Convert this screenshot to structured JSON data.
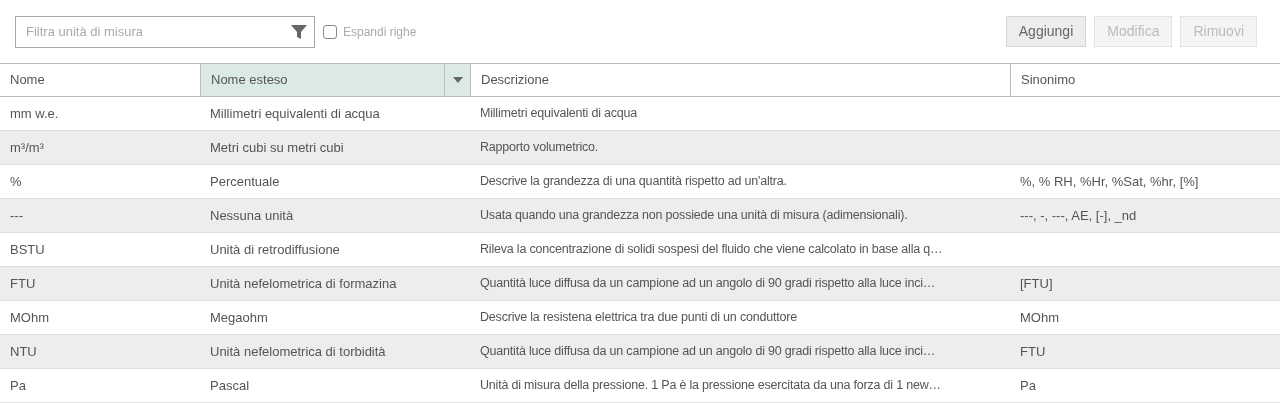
{
  "filter": {
    "placeholder": "Filtra unità di misura"
  },
  "expand_rows": {
    "label": "Espandi righe",
    "checked": false
  },
  "buttons": [
    {
      "label": "Aggiungi",
      "disabled": false
    },
    {
      "label": "Modifica",
      "disabled": true
    },
    {
      "label": "Rimuovi",
      "disabled": true
    }
  ],
  "table": {
    "columns": [
      {
        "label": "Nome",
        "selected": false
      },
      {
        "label": "Nome esteso",
        "selected": true
      },
      {
        "label": "Descrizione",
        "selected": false
      },
      {
        "label": "Sinonimo",
        "selected": false
      }
    ],
    "rows": [
      [
        "mm w.e.",
        "Millimetri equivalenti di acqua",
        "Millimetri equivalenti di acqua",
        ""
      ],
      [
        "m³/m³",
        "Metri cubi su metri cubi",
        "Rapporto volumetrico.",
        ""
      ],
      [
        "%",
        "Percentuale",
        "Descrive la grandezza di una quantità rispetto ad un'altra.",
        "%, % RH, %Hr, %Sat, %hr, [%]"
      ],
      [
        "---",
        "Nessuna unità",
        "Usata quando una grandezza non possiede una unità di misura (adimensionali).",
        "---, -, ---, AE, [-], _nd"
      ],
      [
        "BSTU",
        "Unità di retrodiffusione",
        "Rileva la concentrazione di solidi sospesi del fluido che viene calcolato in base alla q…",
        ""
      ],
      [
        "FTU",
        "Unità nefelometrica di formazina",
        "Quantità luce diffusa da un campione ad un angolo di 90 gradi rispetto alla luce inci…",
        "[FTU]"
      ],
      [
        "MOhm",
        "Megaohm",
        "Descrive la resistena elettrica tra due punti di un conduttore",
        "MOhm"
      ],
      [
        "NTU",
        "Unità nefelometrica di torbidità",
        "Quantità luce diffusa da un campione ad un angolo di 90 gradi rispetto alla luce inci…",
        "FTU"
      ],
      [
        "Pa",
        "Pascal",
        "Unità di misura della pressione. 1 Pa è la pressione esercitata da una forza di 1 new…",
        "Pa"
      ]
    ]
  }
}
